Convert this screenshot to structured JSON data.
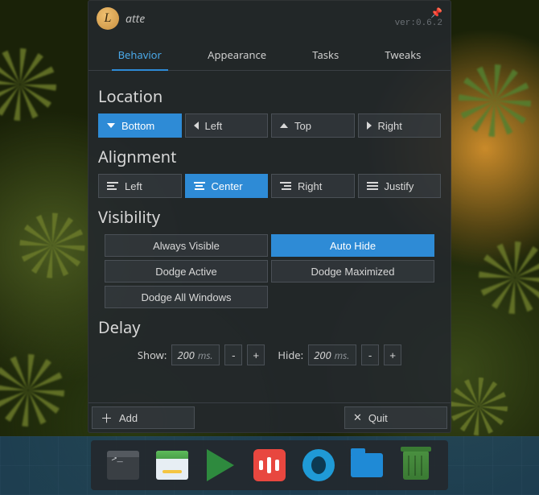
{
  "app": {
    "logo_letter": "L",
    "title": "atte",
    "version": "ver:0.6.2"
  },
  "tabs": {
    "behavior": "Behavior",
    "appearance": "Appearance",
    "tasks": "Tasks",
    "tweaks": "Tweaks"
  },
  "sections": {
    "location": "Location",
    "alignment": "Alignment",
    "visibility": "Visibility",
    "delay": "Delay"
  },
  "location": {
    "bottom": "Bottom",
    "left": "Left",
    "top": "Top",
    "right": "Right"
  },
  "alignment": {
    "left": "Left",
    "center": "Center",
    "right": "Right",
    "justify": "Justify"
  },
  "visibility": {
    "always": "Always Visible",
    "auto_hide": "Auto Hide",
    "dodge_active": "Dodge Active",
    "dodge_max": "Dodge Maximized",
    "dodge_all": "Dodge All Windows"
  },
  "delay": {
    "show_label": "Show:",
    "hide_label": "Hide:",
    "show_value": "200",
    "hide_value": "200",
    "unit": "ms.",
    "minus": "-",
    "plus": "+"
  },
  "footer": {
    "add": "Add",
    "quit": "Quit"
  }
}
